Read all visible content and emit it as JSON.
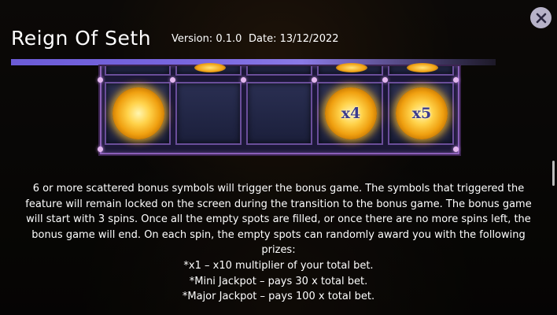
{
  "header": {
    "title": "Reign Of Seth",
    "version": "Version: 0.1.0",
    "date": "Date: 13/12/2022"
  },
  "reels": {
    "top_row": [
      "",
      "",
      "",
      "",
      ""
    ],
    "main_row": [
      "",
      "",
      "",
      "x4",
      "x5"
    ]
  },
  "rules": {
    "paragraph": "6 or more scattered bonus symbols will trigger the bonus game. The symbols that triggered the feature will remain locked on the screen during the transition to the bonus game. The bonus game will start with 3 spins. Once all the empty spots are filled, or once there are no more spins left, the bonus game will end. On each spin, the empty spots can randomly award you with the following prizes:",
    "prizes": [
      "*x1 – x10 multiplier of your total bet.",
      "*Mini Jackpot – pays 30 x total bet.",
      "*Major Jackpot – pays 100 x total bet."
    ]
  },
  "colors": {
    "accent": "#7a68e0",
    "coin_gold": "#f0a010",
    "frame_purple": "#8a5fb8"
  },
  "icons": {
    "close": "close-icon"
  }
}
